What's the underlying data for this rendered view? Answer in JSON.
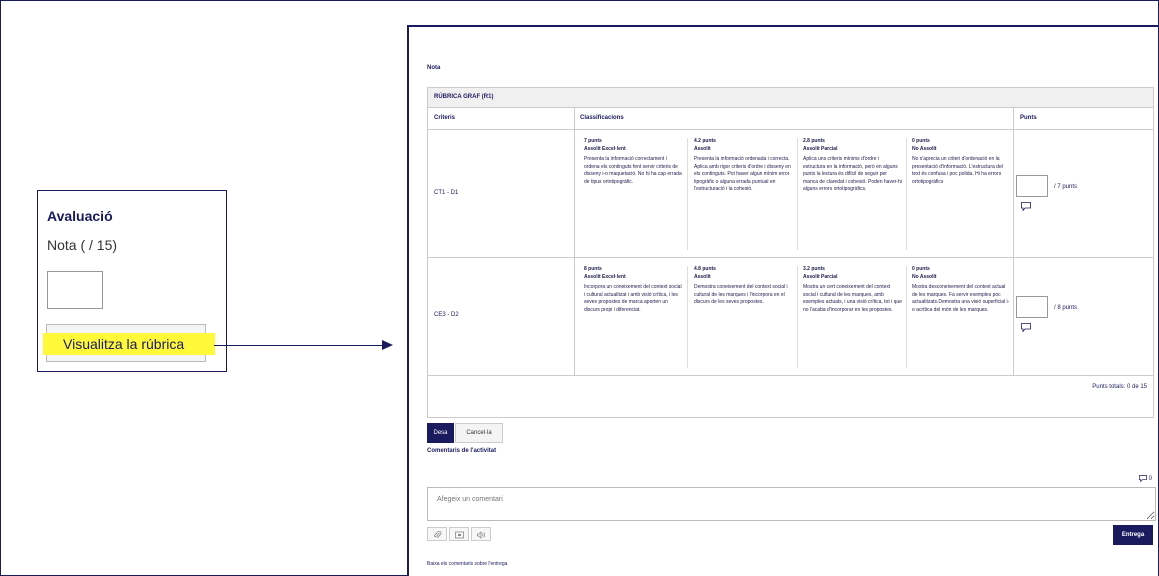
{
  "left_panel": {
    "title": "Avaluació",
    "nota_label": "Nota ( / 15)",
    "grade_value": "",
    "rubric_button": "Visualitza la rúbrica"
  },
  "right_panel": {
    "nota_label": "Nota",
    "rubric_title": "RÚBRICA GRAF (R1)",
    "headers": {
      "criteria": "Criteris",
      "levels": "Classificacions",
      "points": "Punts"
    },
    "rows": [
      {
        "criterion": "CT1 - D1",
        "levels": [
          {
            "points": "7 punts",
            "level": "Assolit Excel·lent",
            "description": "Presenta la informació correctament i ordena els continguts fent servir criteris de disseny i-o maquetació. No hi ha cap errada de tipus ortotipogràfic."
          },
          {
            "points": "4.2 punts",
            "level": "Assolit",
            "description": "Presenta la informació ordenada i correcta. Aplica amb rigor criteris d'ordre i disseny en els continguts. Pot haver algun mínim error tipogràfic o alguna errada puntual en l'estructuració i la cohesió."
          },
          {
            "points": "2.8 punts",
            "level": "Assolit Parcial",
            "description": "Aplica uns criteris mínims d'ordre i estructura en la informació, però en alguns punts la lectura és difícil de seguir per manca de claredat i cohesió. Poden haver-hi alguns errors ortotipogràfics."
          },
          {
            "points": "0 punts",
            "level": "No Assolit",
            "description": "No s'aprecia un criteri d'ordenació en la presentació d'informació. L'estructura del text és confusa i poc polida. Hi ha errors ortotipogràfics"
          }
        ],
        "score_value": "",
        "max_points": "/ 7 punts"
      },
      {
        "criterion": "CE3 - D2",
        "levels": [
          {
            "points": "8 punts",
            "level": "Assolit Excel·lent",
            "description": "Incorpora un coneixement del context social i cultural actualitzat i amb visió crítica, i les seves propostes de marca aporten un discurs propi i diferenciat."
          },
          {
            "points": "4.8 punts",
            "level": "Assolit",
            "description": "Demostra coneixement del context social i cultural de les marques i l'incorpora en el discurs de les seves propostes."
          },
          {
            "points": "3.2 punts",
            "level": "Assolit Parcial",
            "description": "Mostra un cert coneixement del context social i cultural de les marques, amb exemples actuals, i una visió crítica, tot i que no l'acaba d'incorporar en les propostes."
          },
          {
            "points": "0 punts",
            "level": "No Assolit",
            "description": "Mostra desconeixement del context actual de les marques. Fa servir exemples poc actualitzats.Demostra una visió superficial i-o acrítica del món de les marques."
          }
        ],
        "score_value": "",
        "max_points": "/ 8 punts"
      }
    ],
    "totals": "Punts totals: 0 de 15",
    "save_button": "Desa",
    "cancel_button": "Cancel·la",
    "comments_title": "Comentaris de l'activitat",
    "comment_count": "0",
    "comment_placeholder": "Afegeix un comentari",
    "submit_button": "Entrega",
    "download_link": "Baixa els comentaris sobre l'entrega"
  },
  "colors": {
    "accent": "#1a1a5e",
    "highlight": "#fff93a"
  }
}
